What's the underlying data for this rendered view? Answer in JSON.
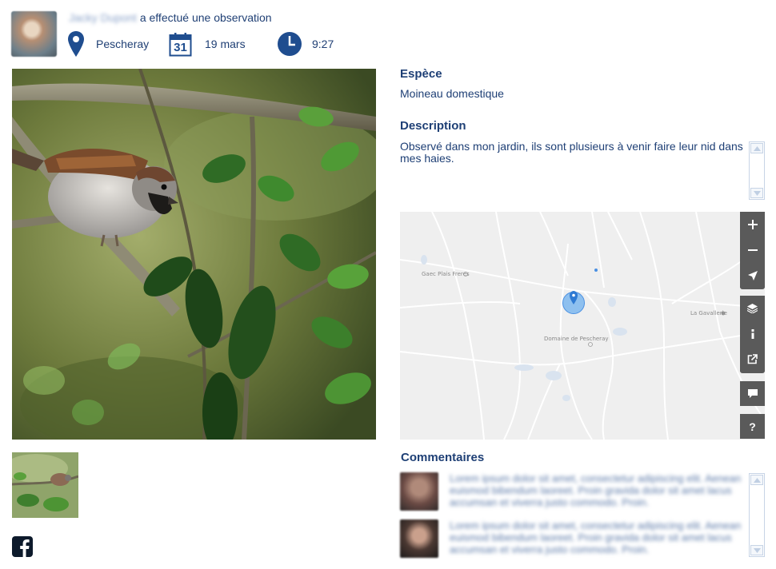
{
  "header": {
    "user_name": "Jacky Dupont",
    "action_text": "a effectué une observation",
    "location": "Pescheray",
    "date_day": "31",
    "date": "19 mars",
    "time": "9:27"
  },
  "details": {
    "species_label": "Espèce",
    "species_value": "Moineau domestique",
    "description_label": "Description",
    "description_value": "Observé dans mon jardin, ils sont plusieurs à venir faire leur nid dans mes haies."
  },
  "map": {
    "place_labels": [
      "Gaec Plais Freres",
      "Domaine de Pescheray",
      "La Gavallerie"
    ],
    "controls": [
      "zoom-in",
      "zoom-out",
      "locate",
      "layers",
      "info",
      "share",
      "comment",
      "help"
    ]
  },
  "comments": {
    "title": "Commentaires",
    "items": [
      {
        "text": "Lorem ipsum dolor sit amet, consectetur adipiscing elit. Aenean euismod bibendum laoreet. Proin gravida dolor sit amet lacus accumsan et viverra justo commodo. Proin."
      },
      {
        "text": "Lorem ipsum dolor sit amet, consectetur adipiscing elit. Aenean euismod bibendum laoreet. Proin gravida dolor sit amet lacus accumsan et viverra justo commodo. Proin."
      }
    ]
  },
  "colors": {
    "text_primary": "#1e3f75",
    "accent_blue": "#1f4d8f",
    "map_control": "#5a5a5a",
    "map_marker": "#4a90e2"
  }
}
